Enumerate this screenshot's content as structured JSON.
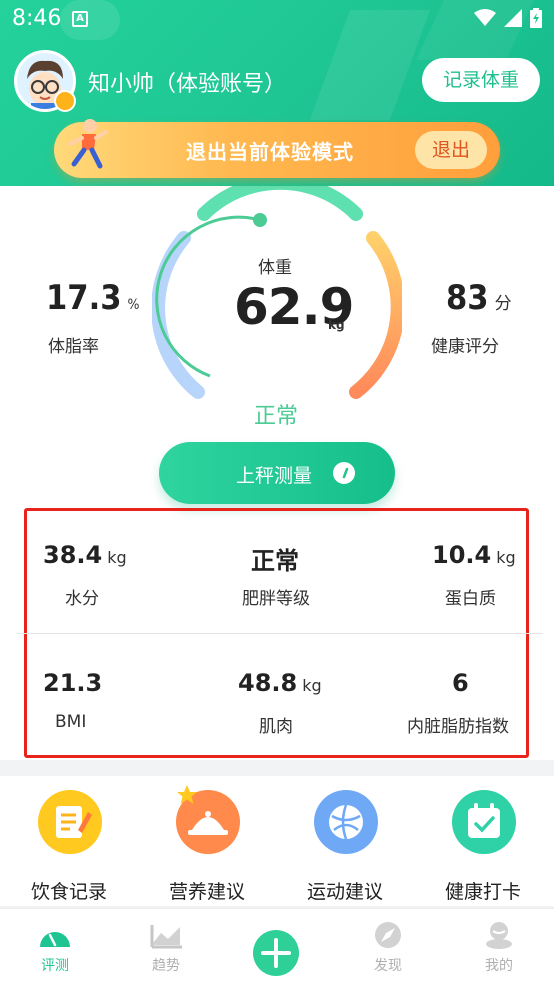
{
  "status_bar": {
    "time": "8:46",
    "app_badge": "A"
  },
  "header": {
    "username": "知小帅（体验账号）",
    "record_button": "记录体重",
    "exit_banner": {
      "text": "退出当前体验模式",
      "button": "退出"
    }
  },
  "summary": {
    "body_fat": {
      "value": "17.3",
      "unit": "%",
      "label": "体脂率"
    },
    "weight": {
      "label": "体重",
      "value": "62.9",
      "unit": "kg"
    },
    "score": {
      "value": "83",
      "unit": "分",
      "label": "健康评分"
    },
    "status": "正常",
    "measure_button": "上秤测量"
  },
  "metrics": [
    {
      "value": "38.4",
      "unit": "kg",
      "label": "水分"
    },
    {
      "value": "正常",
      "unit": "",
      "label": "肥胖等级"
    },
    {
      "value": "10.4",
      "unit": "kg",
      "label": "蛋白质"
    },
    {
      "value": "21.3",
      "unit": "",
      "label": "BMI"
    },
    {
      "value": "48.8",
      "unit": "kg",
      "label": "肌肉"
    },
    {
      "value": "6",
      "unit": "",
      "label": "内脏脂肪指数"
    }
  ],
  "features": [
    {
      "label": "饮食记录",
      "icon": "diet-record-icon",
      "color": "#ffc91f"
    },
    {
      "label": "营养建议",
      "icon": "nutrition-icon",
      "color": "#ff8a4c"
    },
    {
      "label": "运动建议",
      "icon": "exercise-icon",
      "color": "#6fa9f5"
    },
    {
      "label": "健康打卡",
      "icon": "checkin-icon",
      "color": "#2fd1a6"
    }
  ],
  "tabs": [
    {
      "label": "评测",
      "active": true
    },
    {
      "label": "趋势",
      "active": false
    },
    {
      "label": "发现",
      "active": false
    },
    {
      "label": "我的",
      "active": false
    }
  ],
  "colors": {
    "accent": "#1ec593",
    "highlight_border": "#e8231b",
    "banner": "#ffb84f"
  }
}
